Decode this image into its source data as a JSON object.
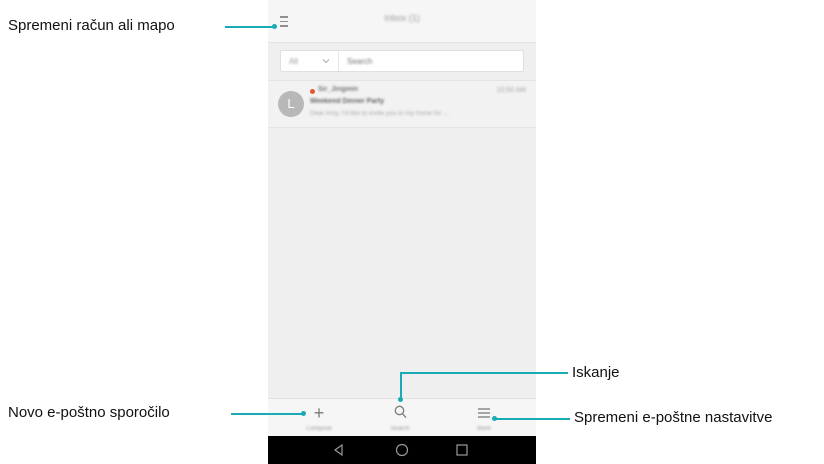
{
  "callouts": {
    "account_or_folder": "Spremeni račun ali mapo",
    "search": "Iskanje",
    "new_email": "Novo e-poštno sporočilo",
    "settings": "Spremeni e-poštne nastavitve"
  },
  "accent_color": "#18aab5",
  "app": {
    "title": "Inbox (1)",
    "filter": {
      "selected": "All",
      "search_placeholder": "Search"
    },
    "messages": [
      {
        "avatar": "L",
        "sender": "Sir_Jingmin",
        "time": "10:50 AM",
        "subject": "Weekend Dinner Party",
        "preview": "Dear Amy, I'd like to invite you to my home for ...",
        "unread": true
      }
    ],
    "bottom_tabs": [
      {
        "icon": "plus-icon",
        "glyph": "+",
        "label": "Compose"
      },
      {
        "icon": "search-icon",
        "glyph": "⚲",
        "label": "Search"
      },
      {
        "icon": "menu-icon",
        "glyph": "≡",
        "label": "More"
      }
    ],
    "nav_buttons": [
      "back-icon",
      "home-icon",
      "recents-icon"
    ]
  }
}
